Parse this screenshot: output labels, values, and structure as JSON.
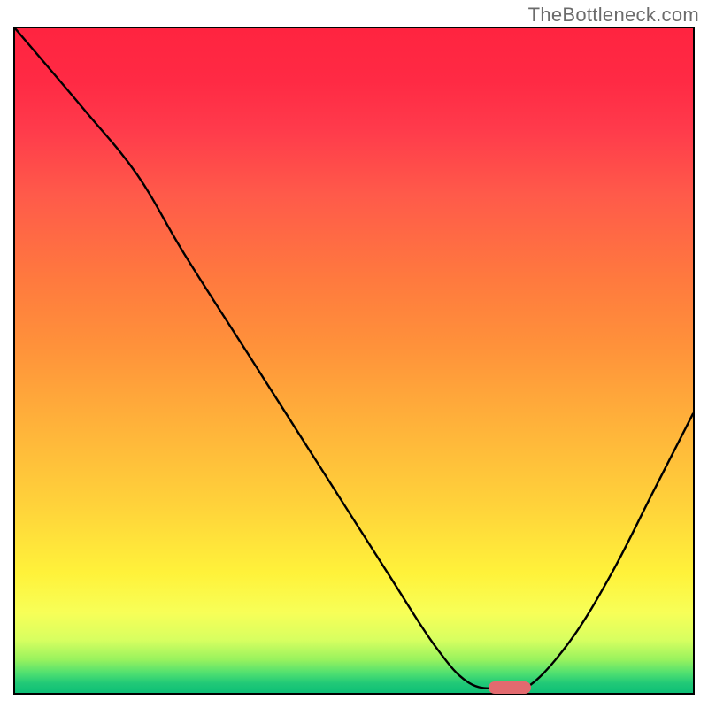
{
  "watermark": "TheBottleneck.com",
  "chart_data": {
    "type": "line",
    "title": "",
    "xlabel": "",
    "ylabel": "",
    "xlim": [
      0,
      100
    ],
    "ylim": [
      0,
      100
    ],
    "grid": false,
    "legend": false,
    "annotations": [],
    "notes": "No visible axis ticks or labels. X and Y expressed as percent of inner plot width/height, y=0 at bottom (green) and y=100 at top (red). Curve starts at top-left, descends to a flat minimum around x≈68–76, then rises toward upper right.",
    "series": [
      {
        "name": "curve",
        "points": [
          {
            "x": 0,
            "y": 100
          },
          {
            "x": 10,
            "y": 88
          },
          {
            "x": 18,
            "y": 78
          },
          {
            "x": 25,
            "y": 66
          },
          {
            "x": 35,
            "y": 50
          },
          {
            "x": 45,
            "y": 34
          },
          {
            "x": 55,
            "y": 18
          },
          {
            "x": 62,
            "y": 7
          },
          {
            "x": 67,
            "y": 1.5
          },
          {
            "x": 72,
            "y": 0.7
          },
          {
            "x": 76,
            "y": 1.2
          },
          {
            "x": 82,
            "y": 8
          },
          {
            "x": 88,
            "y": 18
          },
          {
            "x": 94,
            "y": 30
          },
          {
            "x": 100,
            "y": 42
          }
        ]
      }
    ],
    "marker": {
      "x": 73,
      "y": 0.8,
      "color": "#e36a6f",
      "shape": "pill"
    },
    "background_gradient": {
      "direction": "vertical",
      "stops": [
        {
          "pos": 0.0,
          "color": "#ff2440"
        },
        {
          "pos": 0.5,
          "color": "#ff923a"
        },
        {
          "pos": 0.82,
          "color": "#fff23a"
        },
        {
          "pos": 1.0,
          "color": "#0dbf76"
        }
      ]
    }
  },
  "frame": {
    "inner_left": 17,
    "inner_top": 32,
    "inner_width": 766,
    "inner_height": 751
  }
}
